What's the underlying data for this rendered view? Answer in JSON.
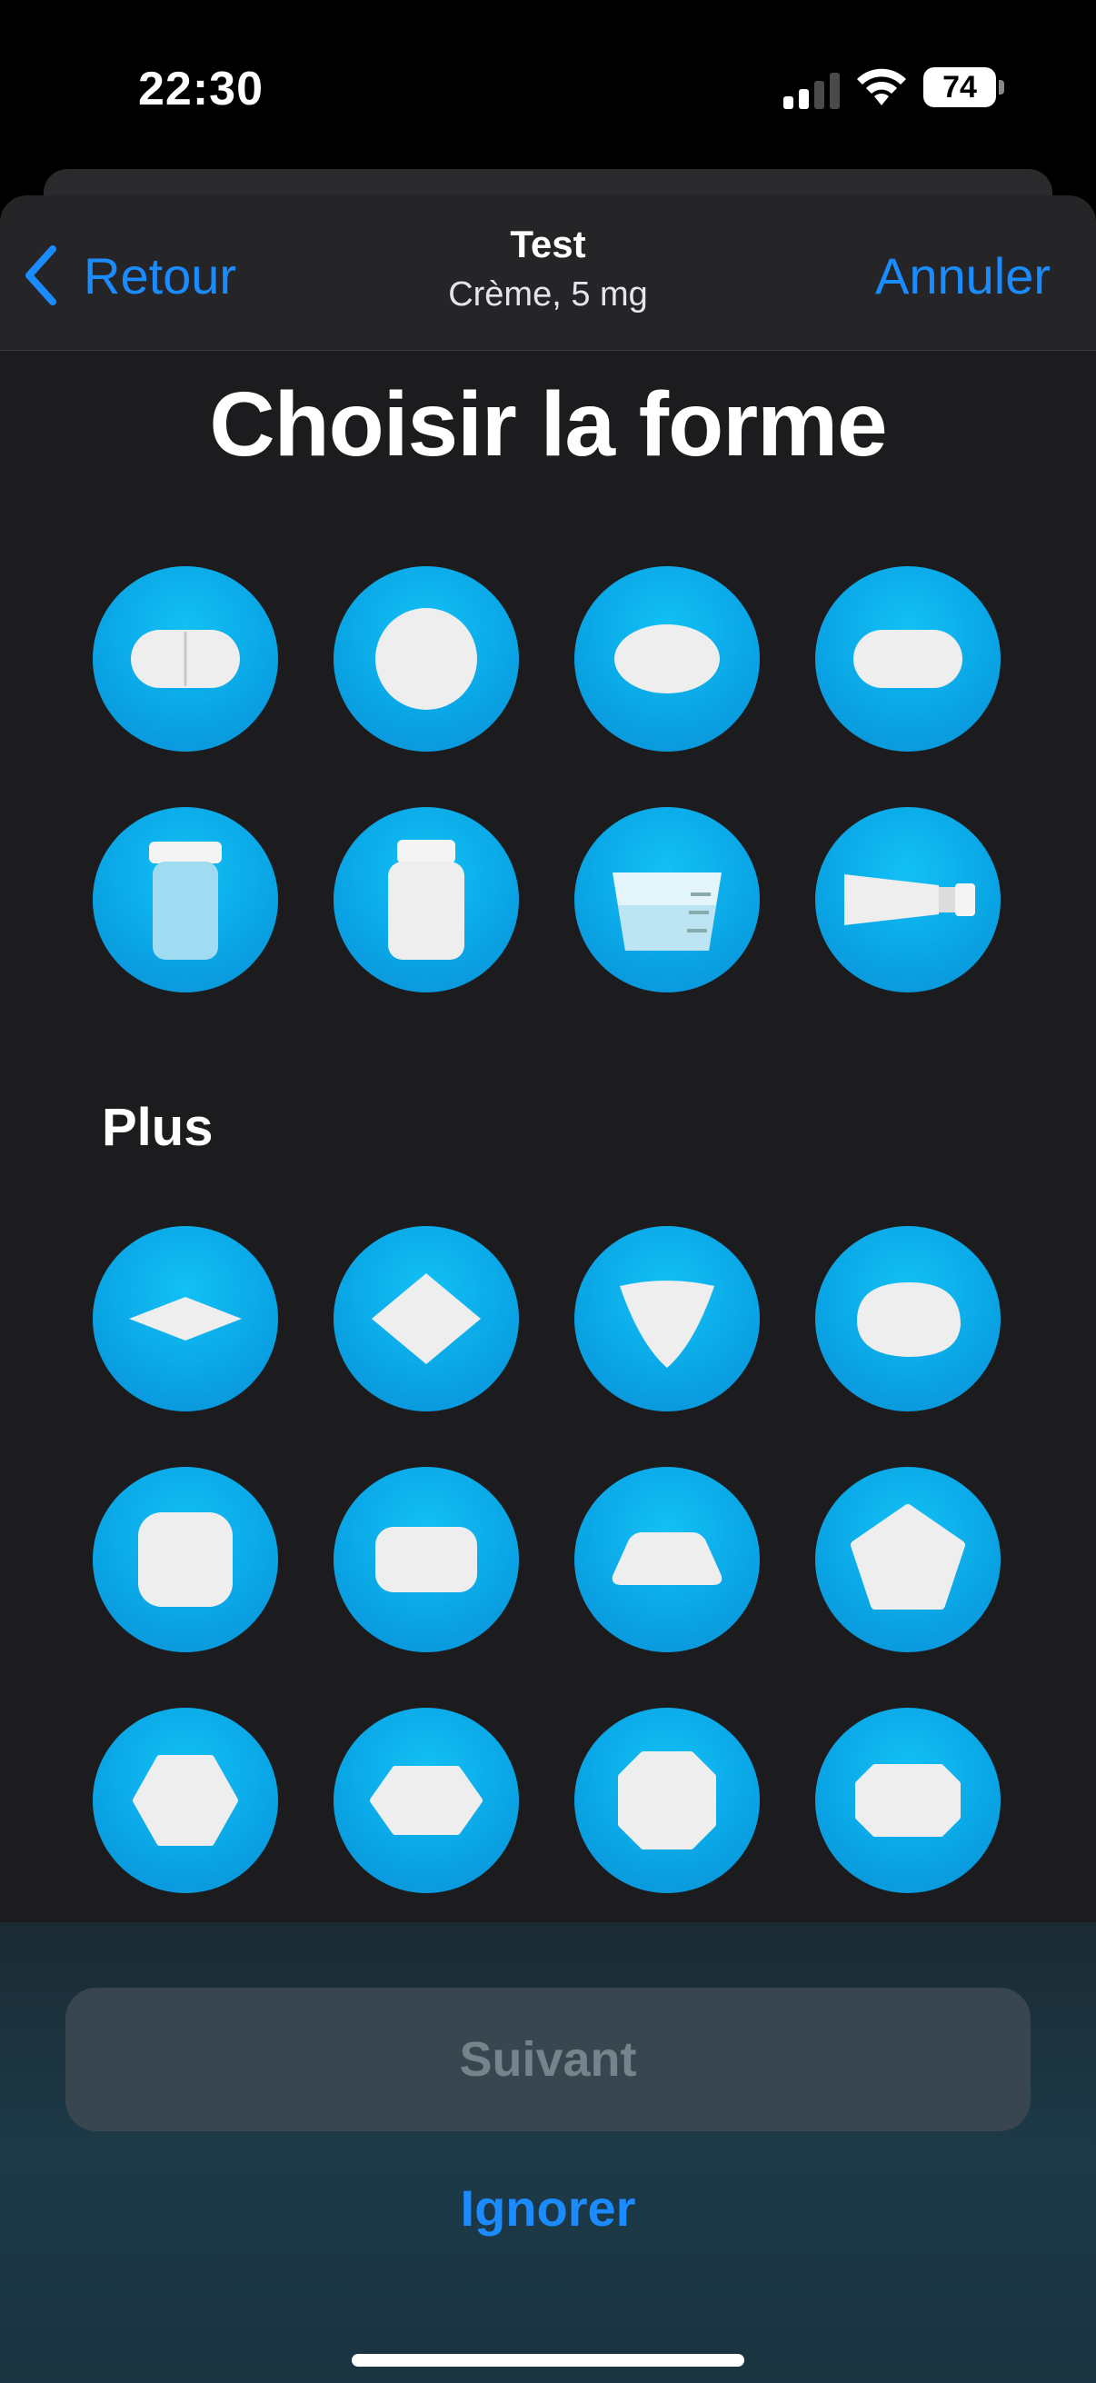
{
  "status_bar": {
    "time": "22:30",
    "battery": "74"
  },
  "nav": {
    "back_label": "Retour",
    "title": "Test",
    "subtitle": "Crème, 5 mg",
    "cancel_label": "Annuler"
  },
  "page_title": "Choisir la forme",
  "section_more": "Plus",
  "shapes": [
    {
      "icon": "capsule-icon"
    },
    {
      "icon": "round-tablet-icon"
    },
    {
      "icon": "oval-tablet-icon"
    },
    {
      "icon": "oblong-tablet-icon"
    },
    {
      "icon": "clear-bottle-icon"
    },
    {
      "icon": "pill-bottle-icon"
    },
    {
      "icon": "measuring-cup-icon"
    },
    {
      "icon": "cream-tube-icon"
    },
    {
      "icon": "diamond-flat-tablet-icon"
    },
    {
      "icon": "diamond-tablet-icon"
    },
    {
      "icon": "triangle-tablet-icon"
    },
    {
      "icon": "egg-tablet-icon"
    },
    {
      "icon": "square-tablet-icon"
    },
    {
      "icon": "rectangle-tablet-icon"
    },
    {
      "icon": "trapezoid-tablet-icon"
    },
    {
      "icon": "pentagon-tablet-icon"
    },
    {
      "icon": "hexagon-tablet-icon"
    },
    {
      "icon": "wide-hexagon-tablet-icon"
    },
    {
      "icon": "octagon-tablet-icon"
    },
    {
      "icon": "wide-octagon-tablet-icon"
    }
  ],
  "footer": {
    "next_label": "Suivant",
    "skip_label": "Ignorer"
  },
  "colors": {
    "accent": "#1a8cff",
    "shape_circle": "#0aa6e6",
    "background": "#1c1c1e"
  }
}
